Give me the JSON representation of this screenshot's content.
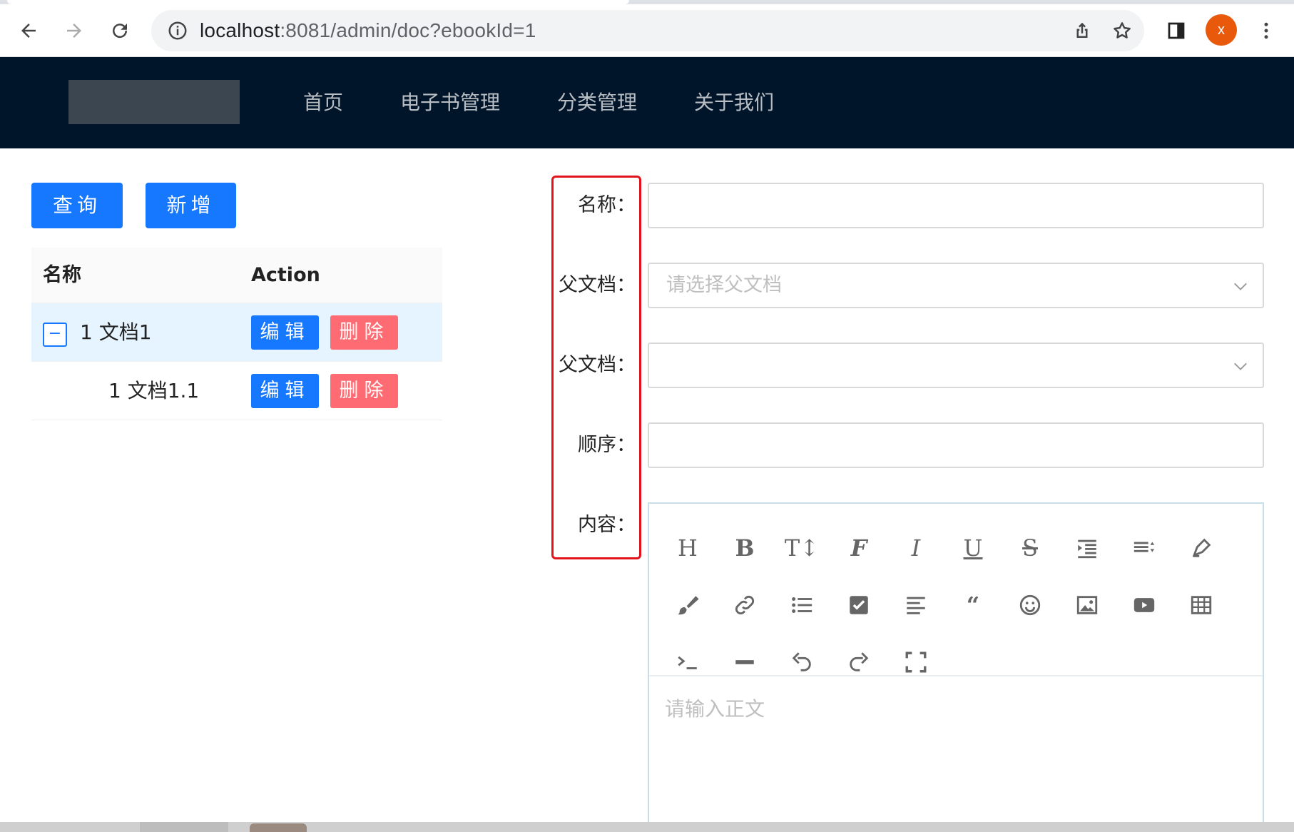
{
  "browser": {
    "url_host": "localhost",
    "url_path": ":8081/admin/doc?ebookId=1",
    "profile_initial": "x"
  },
  "header": {
    "nav": [
      "首页",
      "电子书管理",
      "分类管理",
      "关于我们"
    ]
  },
  "toolbar": {
    "query_label": "查询",
    "add_label": "新增"
  },
  "table": {
    "columns": [
      "名称",
      "Action"
    ],
    "expander_symbol": "−",
    "rows": [
      {
        "name": "1 文档1",
        "edit": "编辑",
        "delete": "删除"
      },
      {
        "name": "1 文档1.1",
        "edit": "编辑",
        "delete": "删除"
      }
    ]
  },
  "form": {
    "labels": [
      "名称：",
      "父文档：",
      "父文档：",
      "顺序：",
      "内容："
    ],
    "name_value": "",
    "parent_placeholder": "请选择父文档",
    "parent2_value": "",
    "sort_value": "",
    "content_placeholder": "请输入正文"
  },
  "editor_tools": [
    "heading-icon",
    "bold-icon",
    "font-size-icon",
    "font-family-icon",
    "italic-icon",
    "underline-icon",
    "strikethrough-icon",
    "indent-icon",
    "line-height-icon",
    "highlight-pen-icon",
    "brush-icon",
    "link-icon",
    "bulleted-list-icon",
    "checkbox-icon",
    "align-icon",
    "quote-icon",
    "emoji-icon",
    "image-icon",
    "video-icon",
    "table-icon",
    "code-icon",
    "divider-icon",
    "undo-icon",
    "redo-icon",
    "fullscreen-icon"
  ],
  "colors": {
    "header_bg": "#001529",
    "primary": "#1677ff",
    "danger": "#ff6b72",
    "annotation": "#e3131b"
  }
}
